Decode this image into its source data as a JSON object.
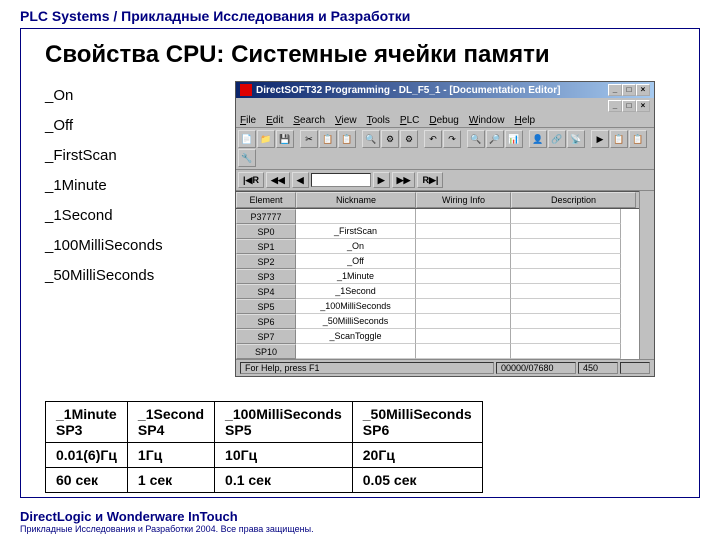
{
  "header": "PLC Systems / Прикладные Исследования и Разработки",
  "title": "Свойства CPU: Системные ячейки памяти",
  "list": [
    "_On",
    "_Off",
    "_FirstScan",
    "_1Minute",
    "_1Second",
    "_100MilliSeconds",
    "_50MilliSeconds"
  ],
  "window": {
    "title": "DirectSOFT32 Programming - DL_F5_1 - [Documentation Editor]",
    "menus": [
      "File",
      "Edit",
      "Search",
      "View",
      "Tools",
      "PLC",
      "Debug",
      "Window",
      "Help"
    ],
    "columns": [
      "Element",
      "Nickname",
      "Wiring Info",
      "Description"
    ],
    "rows": [
      {
        "el": "P37777",
        "nn": ""
      },
      {
        "el": "SP0",
        "nn": "_FirstScan"
      },
      {
        "el": "SP1",
        "nn": "_On"
      },
      {
        "el": "SP2",
        "nn": "_Off"
      },
      {
        "el": "SP3",
        "nn": "_1Minute"
      },
      {
        "el": "SP4",
        "nn": "_1Second"
      },
      {
        "el": "SP5",
        "nn": "_100MilliSeconds"
      },
      {
        "el": "SP6",
        "nn": "_50MilliSeconds"
      },
      {
        "el": "SP7",
        "nn": "_ScanToggle"
      },
      {
        "el": "SP10",
        "nn": ""
      }
    ],
    "status": {
      "help": "For Help, press F1",
      "count": "00000/07680",
      "val": "450"
    }
  },
  "summary": {
    "headers": [
      {
        "name": "_1Minute",
        "sp": "SP3"
      },
      {
        "name": "_1Second",
        "sp": "SP4"
      },
      {
        "name": "_100MilliSeconds",
        "sp": "SP5"
      },
      {
        "name": "_50MilliSeconds",
        "sp": "SP6"
      }
    ],
    "freq": [
      "0.01(6)Гц",
      "1Гц",
      "10Гц",
      "20Гц"
    ],
    "period": [
      "60 сек",
      "1 сек",
      "0.1 сек",
      "0.05 сек"
    ]
  },
  "footer": {
    "line1": "DirectLogic и Wonderware InTouch",
    "line2": "Прикладные Исследования и Разработки 2004. Все права защищены."
  }
}
